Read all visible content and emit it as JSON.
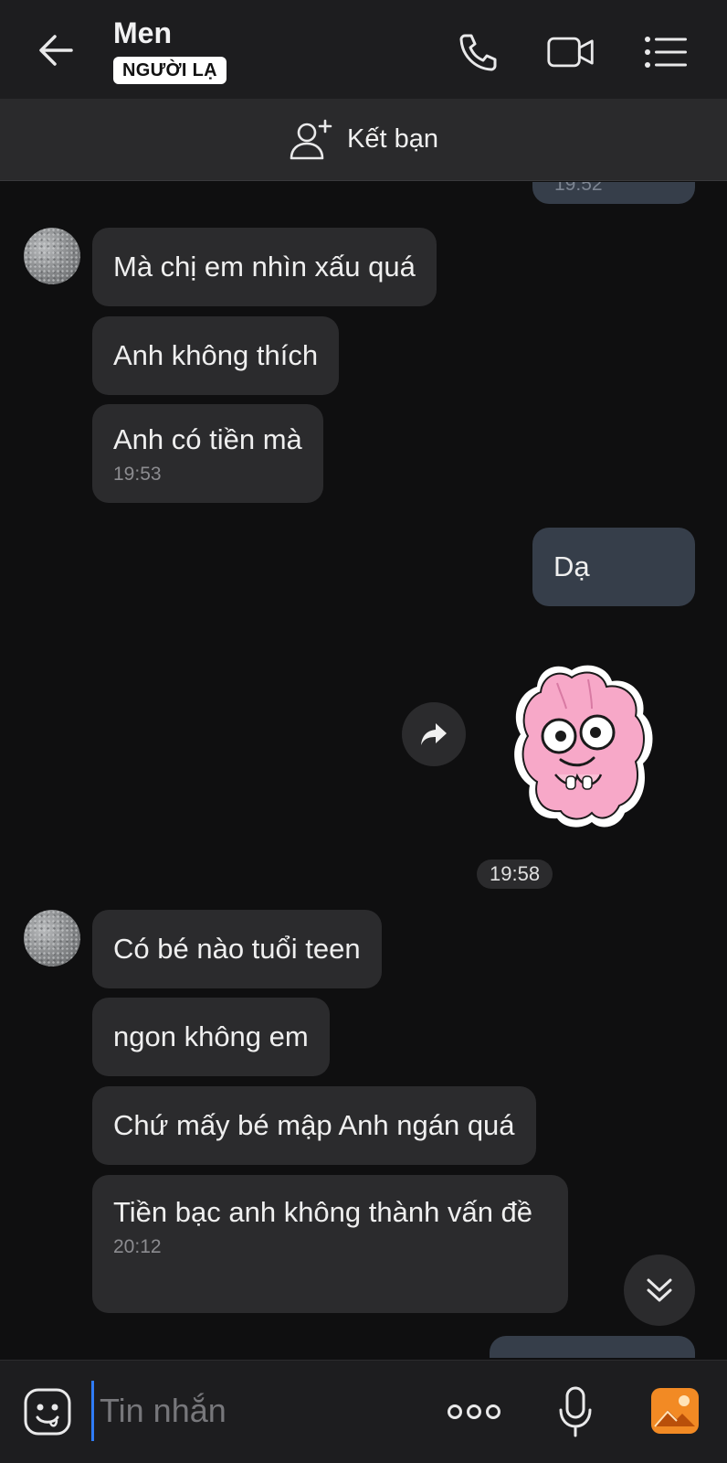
{
  "header": {
    "contact_name": "Men",
    "badge": "NGƯỜI LẠ"
  },
  "add_friend": {
    "label": "Kết bạn"
  },
  "messages": {
    "partial_top_time": "19:52",
    "group1": [
      {
        "text": "Mà chị em nhìn xấu quá"
      },
      {
        "text": "Anh không thích"
      },
      {
        "text": "Anh có tiền mà",
        "time": "19:53"
      }
    ],
    "me1": {
      "text": "Dạ"
    },
    "sticker_time": "19:58",
    "group2": [
      {
        "text": "Có bé nào tuổi teen"
      },
      {
        "text": "ngon không em"
      },
      {
        "text": "Chứ mấy bé mập Anh ngán quá"
      },
      {
        "text": "Tiền bạc anh không thành vấn đề",
        "time": "20:12"
      }
    ]
  },
  "composer": {
    "placeholder": "Tin nhắn"
  },
  "colors": {
    "background": "#0f0f10",
    "bubble_other": "#2b2b2d",
    "bubble_me": "#363e4a",
    "header": "#1d1d1f",
    "image_icon_orange": "#f28a24",
    "caret_blue": "#2f7cf6"
  },
  "icons": [
    "back-arrow-icon",
    "phone-icon",
    "video-camera-icon",
    "menu-list-icon",
    "add-user-icon",
    "forward-icon",
    "scroll-down-icon",
    "emoji-icon",
    "more-dots-icon",
    "microphone-icon",
    "image-icon"
  ]
}
